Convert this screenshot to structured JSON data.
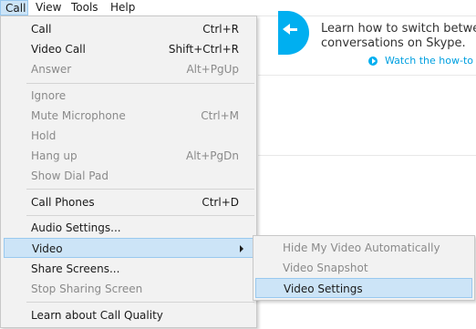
{
  "menubar": {
    "items": [
      {
        "label": "Call"
      },
      {
        "label": "View"
      },
      {
        "label": "Tools"
      },
      {
        "label": "Help"
      }
    ]
  },
  "promo": {
    "line1": "Learn how to switch between",
    "line2": "conversations on Skype.",
    "link": "Watch the how-to vid"
  },
  "call_menu": {
    "items": [
      {
        "label": "Call",
        "shortcut": "Ctrl+R"
      },
      {
        "label": "Video Call",
        "shortcut": "Shift+Ctrl+R"
      },
      {
        "label": "Answer",
        "shortcut": "Alt+PgUp"
      },
      {
        "label": "Ignore",
        "shortcut": ""
      },
      {
        "label": "Mute Microphone",
        "shortcut": "Ctrl+M"
      },
      {
        "label": "Hold",
        "shortcut": ""
      },
      {
        "label": "Hang up",
        "shortcut": "Alt+PgDn"
      },
      {
        "label": "Show Dial Pad",
        "shortcut": ""
      },
      {
        "label": "Call Phones",
        "shortcut": "Ctrl+D"
      },
      {
        "label": "Audio Settings...",
        "shortcut": ""
      },
      {
        "label": "Video",
        "shortcut": ""
      },
      {
        "label": "Share Screens...",
        "shortcut": ""
      },
      {
        "label": "Stop Sharing Screen",
        "shortcut": ""
      },
      {
        "label": "Learn about Call Quality",
        "shortcut": ""
      }
    ]
  },
  "video_submenu": {
    "items": [
      {
        "label": "Hide My Video Automatically"
      },
      {
        "label": "Video Snapshot"
      },
      {
        "label": "Video Settings"
      }
    ]
  },
  "colors": {
    "highlight": "#cce4f7",
    "highlight_border": "#99c9ef",
    "disabled_text": "#8a8a8a",
    "skype_blue": "#00aff0"
  }
}
